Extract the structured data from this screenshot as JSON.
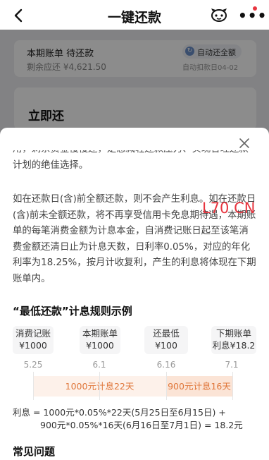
{
  "header": {
    "title": "一键还款",
    "back_icon": "chevron-left-icon",
    "assistant_icon": "robot-assistant-icon",
    "more_icon": "more-dots-icon"
  },
  "bill_card": {
    "title": "本期账单  待还款",
    "remaining": "剩余应还 ¥4,621.50",
    "auto_repay_label": "自动还全额",
    "auto_repay_date": "自动扣款日04-02"
  },
  "repay_card": {
    "title": "立即还"
  },
  "sheet": {
    "close_icon": "close-icon",
    "cut_paragraph": "用，剩余资金慢慢还，是您减轻还款压力、实现合理还款计划的绝佳选择。",
    "main_paragraph": "如在还款日(含)前全额还款，则不会产生利息。如在还款日(含)前未全额还款，将不再享受信用卡免息期待遇，本期账单的每笔消费金额为计息本金，自消费记账日起至该笔消费金额还清日止为计息天数，日利率0.05%，对应的年化利率为18.25%，按月计收复利，产生的利息将体现在下期账单内。",
    "watermark": "L70 CN",
    "example_title": "“最低还款”计息规则示例",
    "timeline": {
      "boxes": [
        {
          "label": "消费记账",
          "value": "¥1000"
        },
        {
          "label": "本期账单",
          "value": "¥1000"
        },
        {
          "label": "还最低",
          "value": "¥100"
        },
        {
          "label": "下期账单",
          "value": "利息¥18.2"
        }
      ],
      "dates": [
        "5.25",
        "6.1",
        "6.16",
        "7.1"
      ],
      "segments": [
        "1000元计息22天",
        "900元计息16天"
      ]
    },
    "formula_line1": "利息 = 1000元*0.05%*22天(5月25日至6月15日) +",
    "formula_line2": "900元*0.05%*16天(6月16日至7月1日) = 18.2元",
    "faq_title": "常见问题"
  }
}
